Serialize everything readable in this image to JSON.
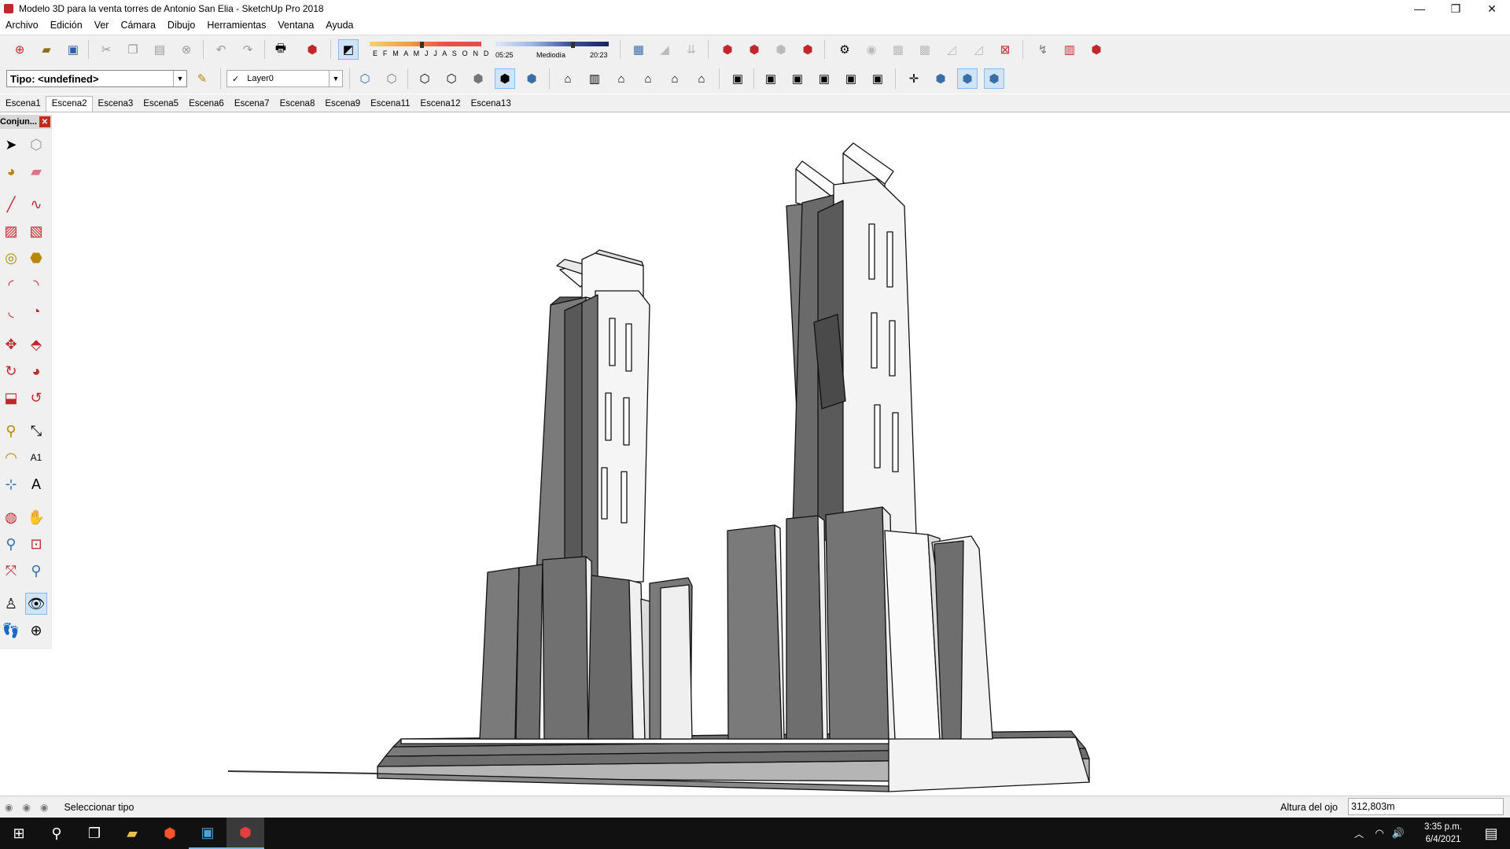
{
  "window": {
    "title": "Modelo 3D para la venta torres de Antonio San Elia - SketchUp Pro 2018",
    "minimize": "—",
    "maximize": "❐",
    "close": "✕"
  },
  "menu": [
    "Archivo",
    "Edición",
    "Ver",
    "Cámara",
    "Dibujo",
    "Herramientas",
    "Ventana",
    "Ayuda"
  ],
  "shadow": {
    "months": "E F M A M J J A S O N D",
    "time_start": "05:25",
    "time_mid": "Mediodía",
    "time_end": "20:23"
  },
  "toolbar2": {
    "tipo_value": "Tipo: <undefined>",
    "layer_check": "✓",
    "layer_value": "Layer0"
  },
  "scenes": {
    "items": [
      "Escena1",
      "Escena2",
      "Escena3",
      "Escena5",
      "Escena6",
      "Escena7",
      "Escena8",
      "Escena9",
      "Escena11",
      "Escena12",
      "Escena13"
    ],
    "active_index": 1
  },
  "tray": {
    "title": "Conjun...",
    "close": "✕"
  },
  "status": {
    "message": "Seleccionar tipo",
    "vcb_label": "Altura del ojo",
    "vcb_value": "312,803m"
  },
  "taskbar": {
    "time": "3:35 p.m.",
    "date": "6/4/2021"
  }
}
